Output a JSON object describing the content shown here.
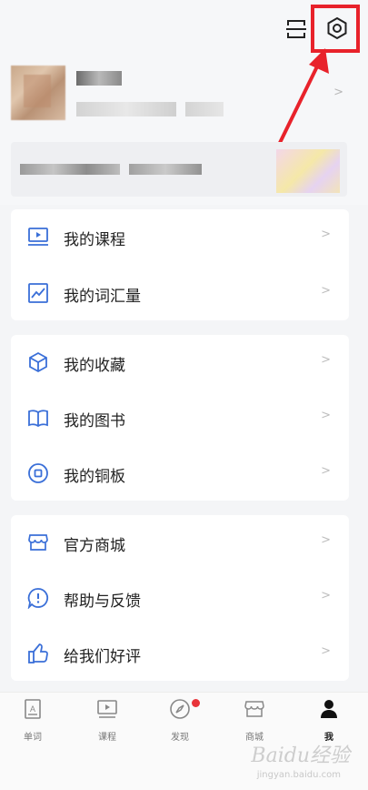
{
  "header": {
    "scan_icon": "scan-icon",
    "settings_icon": "settings-icon"
  },
  "card1": {
    "items": [
      {
        "label": "我的课程",
        "icon": "course-screen-icon"
      },
      {
        "label": "我的词汇量",
        "icon": "vocab-chart-icon"
      }
    ]
  },
  "card2": {
    "items": [
      {
        "label": "我的收藏",
        "icon": "cube-icon"
      },
      {
        "label": "我的图书",
        "icon": "book-icon"
      },
      {
        "label": "我的铜板",
        "icon": "coin-icon"
      }
    ]
  },
  "card3": {
    "items": [
      {
        "label": "官方商城",
        "icon": "store-icon"
      },
      {
        "label": "帮助与反馈",
        "icon": "help-icon"
      },
      {
        "label": "给我们好评",
        "icon": "thumbs-up-icon"
      }
    ]
  },
  "tabs": [
    {
      "label": "单词",
      "icon": "word-card-icon",
      "active": false
    },
    {
      "label": "课程",
      "icon": "course-tab-icon",
      "active": false
    },
    {
      "label": "发现",
      "icon": "compass-icon",
      "active": false
    },
    {
      "label": "商城",
      "icon": "shop-tab-icon",
      "active": false
    },
    {
      "label": "我",
      "icon": "user-icon",
      "active": true
    }
  ],
  "watermark": {
    "main": "Baidu经验",
    "sub": "jingyan.baidu.com"
  },
  "colors": {
    "accent": "#3a6fd8",
    "highlight": "#e8222b",
    "badge": "#e8343a"
  }
}
